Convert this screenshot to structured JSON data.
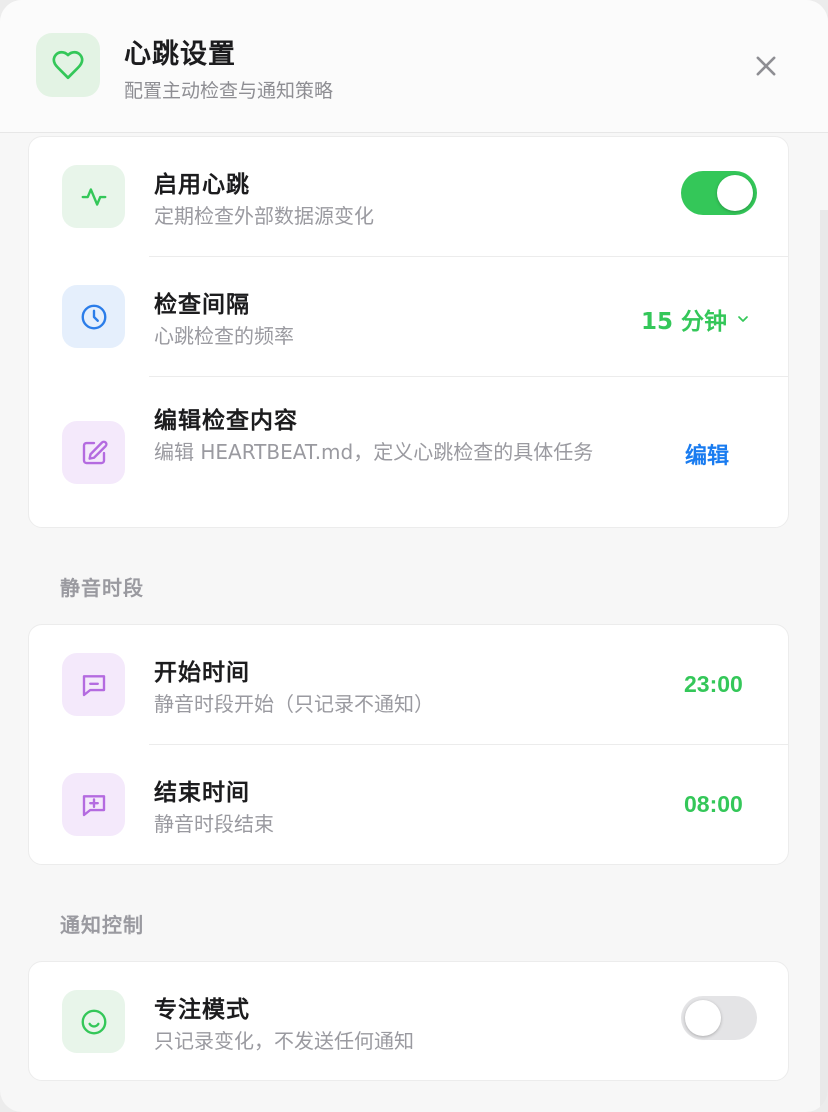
{
  "header": {
    "title": "心跳设置",
    "subtitle": "配置主动检查与通知策略",
    "icon": "heart-icon",
    "close_icon": "close-icon"
  },
  "heartbeat_card": {
    "enable": {
      "title": "启用心跳",
      "subtitle": "定期检查外部数据源变化",
      "icon": "activity-icon",
      "toggle_on": true
    },
    "interval": {
      "title": "检查间隔",
      "subtitle": "心跳检查的频率",
      "icon": "clock-icon",
      "value": "15 分钟"
    },
    "edit": {
      "title": "编辑检查内容",
      "subtitle": "编辑 HEARTBEAT.md，定义心跳检查的具体任务",
      "icon": "edit-icon",
      "action": "编辑"
    }
  },
  "quiet_section": {
    "label": "静音时段",
    "start": {
      "title": "开始时间",
      "subtitle": "静音时段开始（只记录不通知）",
      "icon": "message-minus-icon",
      "value": "23:00"
    },
    "end": {
      "title": "结束时间",
      "subtitle": "静音时段结束",
      "icon": "message-plus-icon",
      "value": "08:00"
    }
  },
  "notify_section": {
    "label": "通知控制",
    "focus": {
      "title": "专注模式",
      "subtitle": "只记录变化，不发送任何通知",
      "icon": "smile-icon",
      "toggle_on": false
    }
  },
  "colors": {
    "accent_green": "#34c759",
    "link_blue": "#1a7cf0",
    "purple": "#b46be0",
    "blue": "#2b7de9"
  }
}
